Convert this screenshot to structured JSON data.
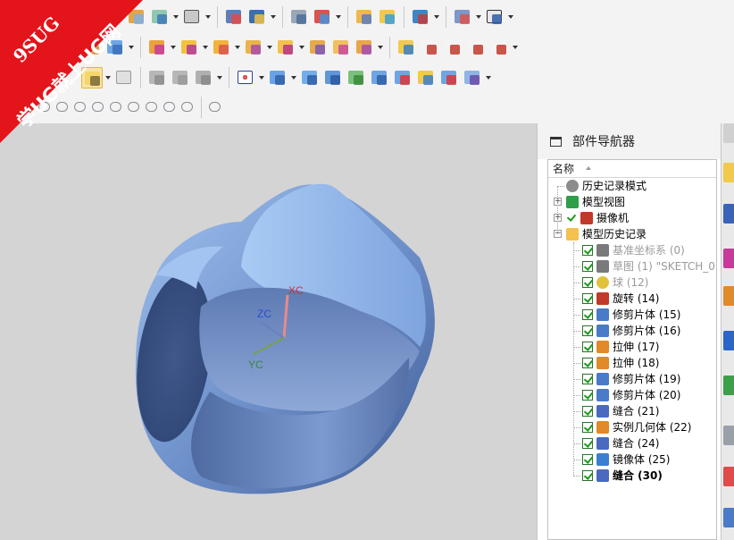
{
  "watermark": {
    "line1": "9SUG",
    "line2": "学UG就上UG网"
  },
  "navigator": {
    "title": "部件导航器",
    "column_header": "名称",
    "items": [
      {
        "label": "历史记录模式",
        "style": "normal",
        "icon": "clock-icon",
        "expander": "",
        "checkbox": false
      },
      {
        "label": "模型视图",
        "style": "normal",
        "icon": "model-views-icon",
        "expander": "+",
        "checkbox": false
      },
      {
        "label": "摄像机",
        "style": "normal",
        "icon": "camera-icon",
        "expander": "+",
        "checkbox": false
      },
      {
        "label": "模型历史记录",
        "style": "normal",
        "icon": "folder-open-icon",
        "expander": "-",
        "checkbox": false
      },
      {
        "label": "基准坐标系 (0)",
        "style": "grey",
        "icon": "datum-csys-icon",
        "checkbox": true
      },
      {
        "label": "草图 (1) \"SKETCH_0...",
        "style": "grey",
        "icon": "sketch-icon",
        "checkbox": true
      },
      {
        "label": "球 (12)",
        "style": "grey",
        "icon": "sphere-icon",
        "checkbox": true
      },
      {
        "label": "旋转 (14)",
        "style": "normal",
        "icon": "revolve-icon",
        "checkbox": true
      },
      {
        "label": "修剪片体 (15)",
        "style": "normal",
        "icon": "trim-sheet-icon",
        "checkbox": true
      },
      {
        "label": "修剪片体 (16)",
        "style": "normal",
        "icon": "trim-sheet-icon",
        "checkbox": true
      },
      {
        "label": "拉伸 (17)",
        "style": "normal",
        "icon": "extrude-icon",
        "checkbox": true
      },
      {
        "label": "拉伸 (18)",
        "style": "normal",
        "icon": "extrude-icon",
        "checkbox": true
      },
      {
        "label": "修剪片体 (19)",
        "style": "normal",
        "icon": "trim-sheet-icon",
        "checkbox": true
      },
      {
        "label": "修剪片体 (20)",
        "style": "normal",
        "icon": "trim-sheet-icon",
        "checkbox": true
      },
      {
        "label": "缝合 (21)",
        "style": "normal",
        "icon": "sew-icon",
        "checkbox": true
      },
      {
        "label": "实例几何体 (22)",
        "style": "normal",
        "icon": "instance-geometry-icon",
        "checkbox": true
      },
      {
        "label": "缝合 (24)",
        "style": "normal",
        "icon": "sew-icon",
        "checkbox": true
      },
      {
        "label": "镜像体 (25)",
        "style": "normal",
        "icon": "mirror-body-icon",
        "checkbox": true
      },
      {
        "label": "缝合 (30)",
        "style": "bold",
        "icon": "sew-icon",
        "checkbox": true
      }
    ]
  },
  "viewport": {
    "triad": {
      "x_label": "XC",
      "y_label": "YC",
      "z_label": "ZC"
    },
    "colors": {
      "background": "#d4d4d4",
      "surface_light": "#a9c8f0",
      "surface_dark": "#4e6ea6"
    }
  }
}
